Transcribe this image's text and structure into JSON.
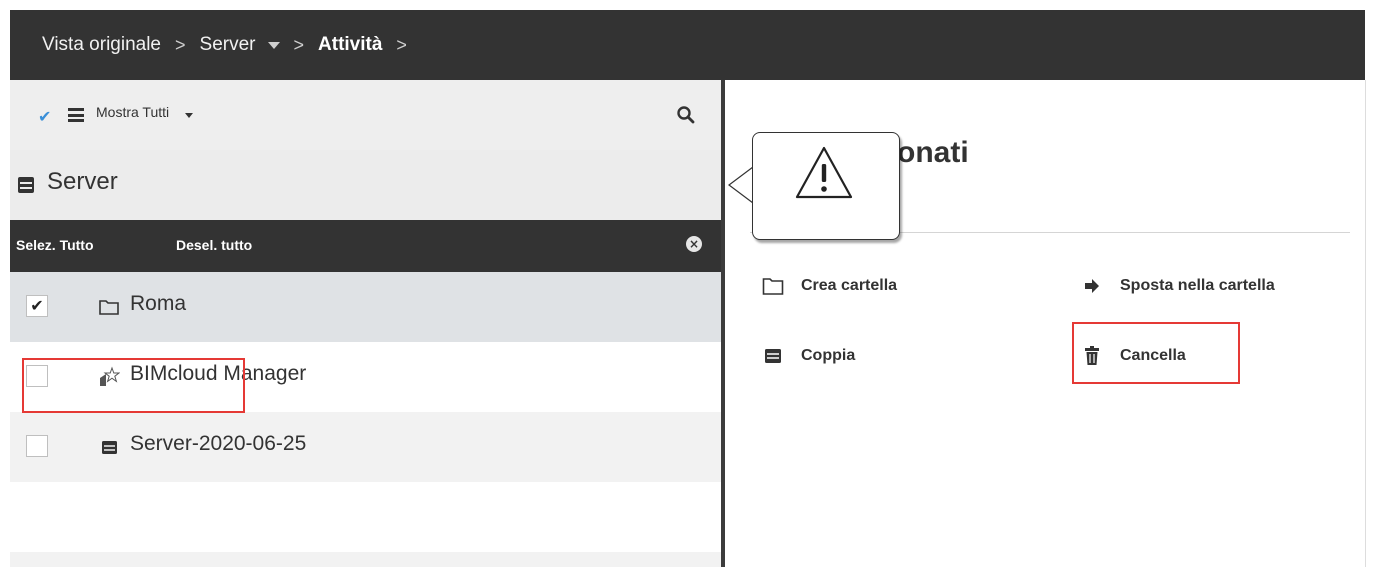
{
  "breadcrumb": {
    "items": [
      {
        "label": "Vista originale"
      },
      {
        "label": "Server"
      },
      {
        "label": "Attività"
      }
    ]
  },
  "toolbar": {
    "filter_label": "Mostra Tutti"
  },
  "left": {
    "section_title": "Server",
    "select_all": "Selez. Tutto",
    "deselect_all": "Desel. tutto",
    "items": [
      {
        "label": "Roma",
        "checked": true,
        "icon": "folder-icon"
      },
      {
        "label": "BIMcloud Manager",
        "checked": false,
        "icon": "manager-star-icon"
      },
      {
        "label": "Server-2020-06-25",
        "checked": false,
        "icon": "server-icon"
      }
    ]
  },
  "right": {
    "title_fragment": "onati",
    "actions": [
      {
        "label": "Crea cartella",
        "icon": "folder-icon"
      },
      {
        "label": "Sposta nella cartella",
        "icon": "arrow-right-icon"
      },
      {
        "label": "Coppia",
        "icon": "server-icon"
      },
      {
        "label": "Cancella",
        "icon": "trash-icon"
      }
    ]
  },
  "colors": {
    "topbar": "#333333",
    "highlight": "#e53935",
    "check_accent": "#3a8fd8"
  }
}
